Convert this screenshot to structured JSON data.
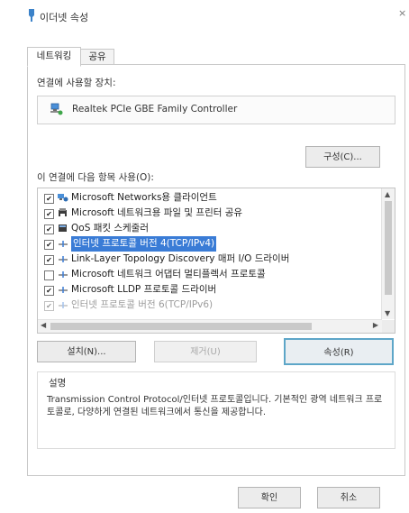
{
  "window": {
    "title": "이더넷 속성",
    "close": "×"
  },
  "tabs": [
    {
      "label": "네트워킹",
      "active": true
    },
    {
      "label": "공유",
      "active": false
    }
  ],
  "connect_label": "연결에 사용할 장치:",
  "adapter": {
    "name": "Realtek PCIe GBE Family Controller",
    "icon": "network-adapter-icon"
  },
  "configure_button": "구성(C)...",
  "items_label": "이 연결에 다음 항목 사용(O):",
  "items": [
    {
      "label": "Microsoft Networks용 클라이언트",
      "checked": true,
      "icon": "network-client-icon"
    },
    {
      "label": "Microsoft 네트워크용 파일 및 프린터 공유",
      "checked": true,
      "icon": "printer-sharing-icon"
    },
    {
      "label": "QoS 패킷 스케줄러",
      "checked": true,
      "icon": "qos-scheduler-icon"
    },
    {
      "label": "인터넷 프로토콜 버전 4(TCP/IPv4)",
      "checked": true,
      "icon": "protocol-icon",
      "selected": true
    },
    {
      "label": "Link-Layer Topology Discovery 매퍼 I/O 드라이버",
      "checked": true,
      "icon": "protocol-icon"
    },
    {
      "label": "Microsoft 네트워크 어댑터 멀티플렉서 프로토콜",
      "checked": false,
      "icon": "protocol-icon"
    },
    {
      "label": "Microsoft LLDP 프로토콜 드라이버",
      "checked": true,
      "icon": "protocol-icon"
    },
    {
      "label": "인터넷 프로토콜 버전 6(TCP/IPv6)",
      "checked": true,
      "icon": "protocol-icon"
    }
  ],
  "buttons": {
    "install": "설치(N)...",
    "uninstall": "제거(U)",
    "properties": "속성(R)",
    "ok": "확인",
    "cancel": "취소"
  },
  "description": {
    "title": "설명",
    "text": "Transmission Control Protocol/인터넷 프로토콜입니다. 기본적인 광역 네트워크 프로토콜로, 다양하게 연결된 네트워크에서 통신을 제공합니다."
  },
  "colors": {
    "selection": "#3a7cd6",
    "focus_border": "#5da6c8"
  }
}
